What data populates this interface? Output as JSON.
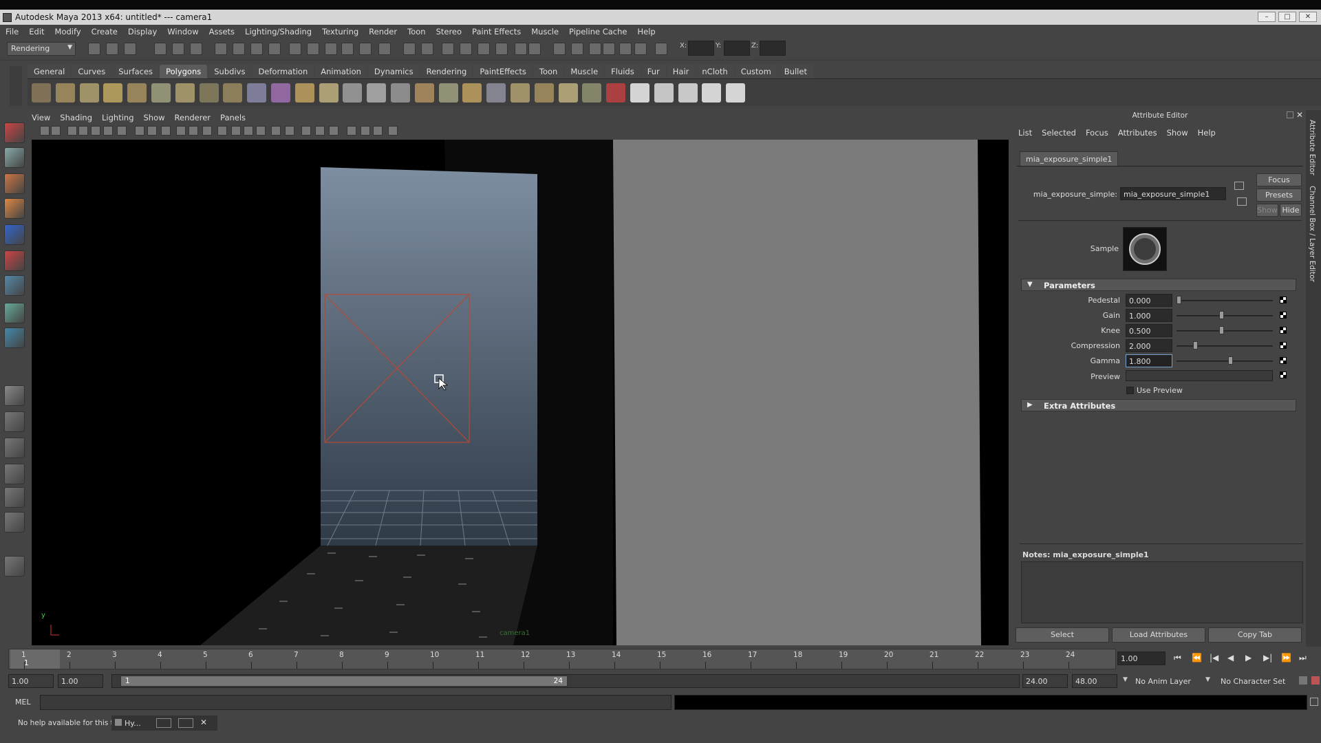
{
  "app": {
    "title": "Autodesk Maya 2013 x64: untitled*   ---   camera1"
  },
  "menubar": [
    "File",
    "Edit",
    "Modify",
    "Create",
    "Display",
    "Window",
    "Assets",
    "Lighting/Shading",
    "Texturing",
    "Render",
    "Toon",
    "Stereo",
    "Paint Effects",
    "Muscle",
    "Pipeline Cache",
    "Help"
  ],
  "statusline": {
    "menuset": "Rendering",
    "x_label": "X:",
    "y_label": "Y:",
    "z_label": "Z:"
  },
  "shelf": {
    "tabs": [
      "General",
      "Curves",
      "Surfaces",
      "Polygons",
      "Subdivs",
      "Deformation",
      "Animation",
      "Dynamics",
      "Rendering",
      "PaintEffects",
      "Toon",
      "Muscle",
      "Fluids",
      "Fur",
      "Hair",
      "nCloth",
      "Custom",
      "Bullet"
    ],
    "active_tab": "Polygons"
  },
  "panel": {
    "menu": [
      "View",
      "Shading",
      "Lighting",
      "Show",
      "Renderer",
      "Panels"
    ],
    "camera_label": "camera1",
    "axis_y": "y",
    "axis_x": "x"
  },
  "attribute_editor": {
    "title": "Attribute Editor",
    "menu": [
      "List",
      "Selected",
      "Focus",
      "Attributes",
      "Show",
      "Help"
    ],
    "tab": "mia_exposure_simple1",
    "node_label": "mia_exposure_simple:",
    "node_value": "mia_exposure_simple1",
    "buttons": {
      "focus": "Focus",
      "presets": "Presets",
      "show": "Show",
      "hide": "Hide"
    },
    "sample_label": "Sample",
    "sections": {
      "parameters": "Parameters",
      "extra": "Extra Attributes"
    },
    "params": [
      {
        "label": "Pedestal",
        "value": "0.000",
        "level": 0.0
      },
      {
        "label": "Gain",
        "value": "1.000",
        "level": 0.46
      },
      {
        "label": "Knee",
        "value": "0.500",
        "level": 0.46
      },
      {
        "label": "Compression",
        "value": "2.000",
        "level": 0.18
      },
      {
        "label": "Gamma",
        "value": "1.800",
        "level": 0.56
      }
    ],
    "preview_label": "Preview",
    "use_preview_label": "Use Preview",
    "notes": "Notes:  mia_exposure_simple1",
    "bottom_buttons": [
      "Select",
      "Load Attributes",
      "Copy Tab"
    ]
  },
  "side_tabs": [
    "Attribute Editor",
    "Channel Box / Layer Editor"
  ],
  "timeslider": {
    "frames": [
      "1",
      "2",
      "3",
      "4",
      "5",
      "6",
      "7",
      "8",
      "9",
      "10",
      "11",
      "12",
      "13",
      "14",
      "15",
      "16",
      "17",
      "18",
      "19",
      "20",
      "21",
      "22",
      "23",
      "24"
    ],
    "current": "1",
    "current_field": "1.00"
  },
  "range": {
    "start": "1.00",
    "playstart": "1.00",
    "handle_start": "1",
    "handle_end": "24",
    "playend": "24.00",
    "end": "48.00",
    "anim_layer": "No Anim Layer",
    "char_set": "No Character Set"
  },
  "cmdline": {
    "label": "MEL"
  },
  "helpline": {
    "text": "No help available for this tool",
    "task": "Hy..."
  }
}
